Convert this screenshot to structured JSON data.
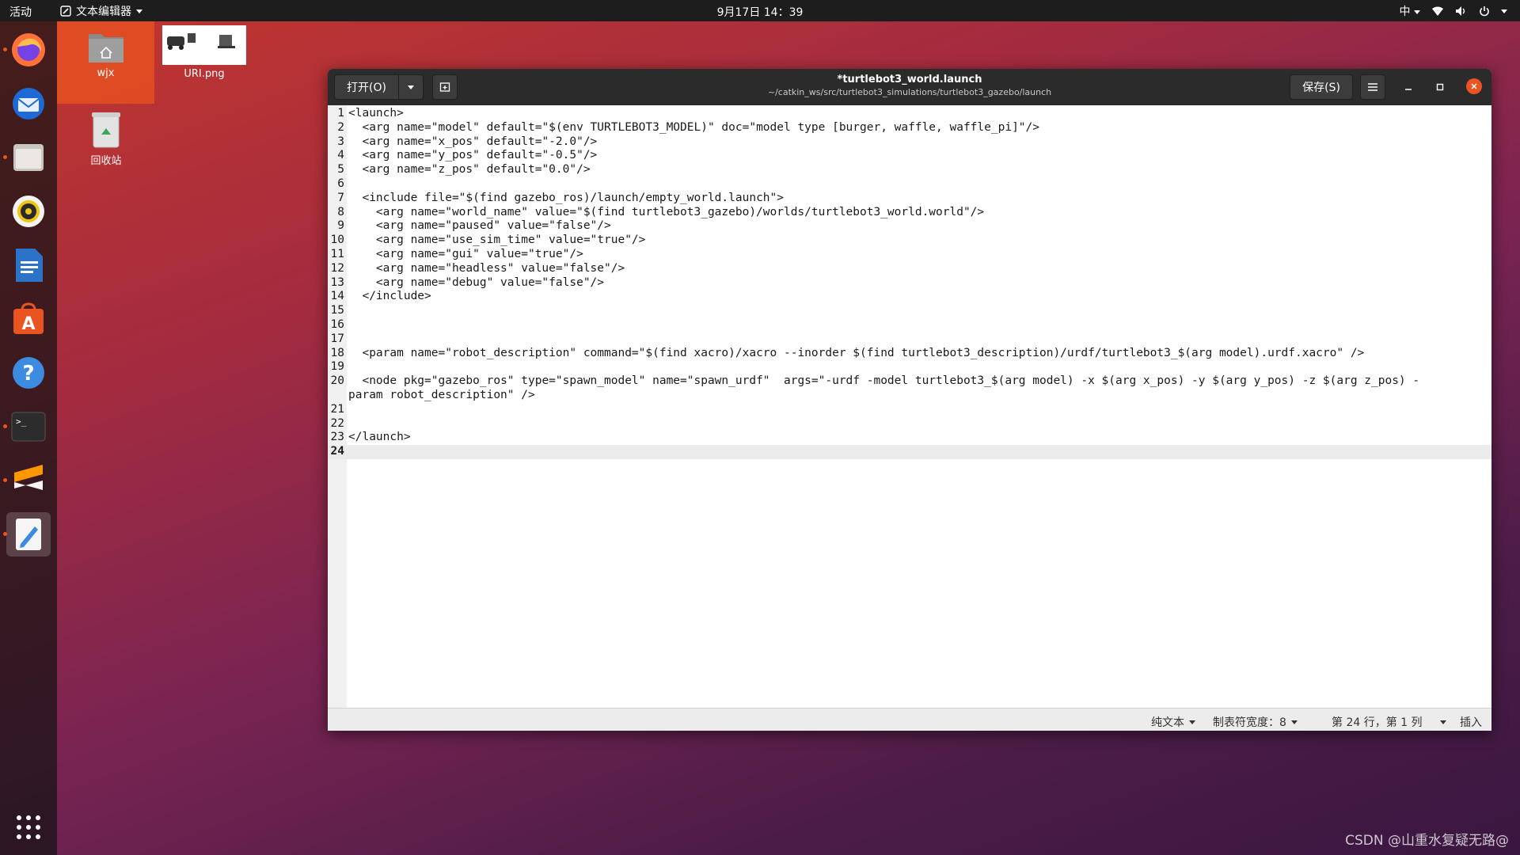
{
  "topbar": {
    "activities": "活动",
    "app_name": "文本编辑器",
    "clock": "9月17日  14：39",
    "input_method": "中"
  },
  "desktop": {
    "icons": [
      {
        "label": "wjx"
      },
      {
        "label": "URI.png"
      },
      {
        "label": "回收站"
      }
    ]
  },
  "dock": {
    "items": [
      "firefox",
      "thunderbird",
      "files",
      "rhythmbox",
      "libreoffice-writer",
      "ubuntu-software",
      "help",
      "terminal",
      "sublime-text",
      "text-editor"
    ],
    "show_apps": "show-applications"
  },
  "window": {
    "open_label": "打开(O)",
    "title": "*turtlebot3_world.launch",
    "subtitle": "~/catkin_ws/src/turtlebot3_simulations/turtlebot3_gazebo/launch",
    "save_label": "保存(S)"
  },
  "editor": {
    "lines": [
      {
        "n": "1",
        "text": "<launch>"
      },
      {
        "n": "2",
        "text": "  <arg name=\"model\" default=\"$(env TURTLEBOT3_MODEL)\" doc=\"model type [burger, waffle, waffle_pi]\"/>"
      },
      {
        "n": "3",
        "text": "  <arg name=\"x_pos\" default=\"-2.0\"/>"
      },
      {
        "n": "4",
        "text": "  <arg name=\"y_pos\" default=\"-0.5\"/>"
      },
      {
        "n": "5",
        "text": "  <arg name=\"z_pos\" default=\"0.0\"/>"
      },
      {
        "n": "6",
        "text": ""
      },
      {
        "n": "7",
        "text": "  <include file=\"$(find gazebo_ros)/launch/empty_world.launch\">"
      },
      {
        "n": "8",
        "text": "    <arg name=\"world_name\" value=\"$(find turtlebot3_gazebo)/worlds/turtlebot3_world.world\"/>"
      },
      {
        "n": "9",
        "text": "    <arg name=\"paused\" value=\"false\"/>"
      },
      {
        "n": "10",
        "text": "    <arg name=\"use_sim_time\" value=\"true\"/>"
      },
      {
        "n": "11",
        "text": "    <arg name=\"gui\" value=\"true\"/>"
      },
      {
        "n": "12",
        "text": "    <arg name=\"headless\" value=\"false\"/>"
      },
      {
        "n": "13",
        "text": "    <arg name=\"debug\" value=\"false\"/>"
      },
      {
        "n": "14",
        "text": "  </include>"
      },
      {
        "n": "15",
        "text": ""
      },
      {
        "n": "16",
        "text": ""
      },
      {
        "n": "17",
        "text": ""
      },
      {
        "n": "18",
        "text": "  <param name=\"robot_description\" command=\"$(find xacro)/xacro --inorder $(find turtlebot3_description)/urdf/turtlebot3_$(arg model).urdf.xacro\" />"
      },
      {
        "n": "19",
        "text": ""
      },
      {
        "n": "20",
        "text": "  <node pkg=\"gazebo_ros\" type=\"spawn_model\" name=\"spawn_urdf\"  args=\"-urdf -model turtlebot3_$(arg model) -x $(arg x_pos) -y $(arg y_pos) -z $(arg z_pos) -\nparam robot_description\" />"
      },
      {
        "n": "21",
        "text": ""
      },
      {
        "n": "22",
        "text": ""
      },
      {
        "n": "23",
        "text": "</launch>"
      },
      {
        "n": "24",
        "text": ""
      }
    ]
  },
  "statusbar": {
    "language": "纯文本",
    "tab_width": "制表符宽度：8",
    "position": "第 24 行，第 1 列",
    "mode": "插入"
  },
  "watermark": "CSDN @山重水复疑无路@",
  "colors": {
    "accent": "#e95420",
    "header": "#2b2b2b",
    "topbar": "#1d1d1d"
  }
}
